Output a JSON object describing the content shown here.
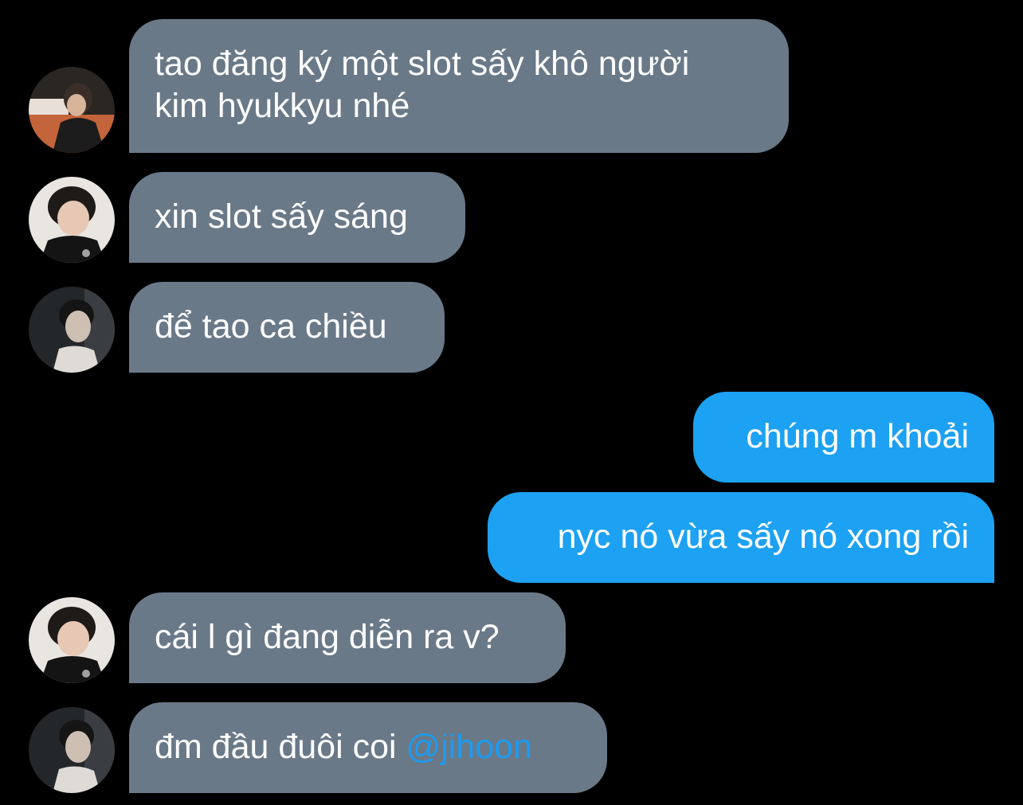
{
  "messages": [
    {
      "side": "in",
      "avatar": "avatar-faker",
      "line1": "tao đăng ký một slot sấy khô người",
      "line2": "kim hyukkyu nhé"
    },
    {
      "side": "in",
      "avatar": "avatar-keria",
      "text": "xin slot sấy sáng"
    },
    {
      "side": "in",
      "avatar": "avatar-gumayusi",
      "text": "để tao ca chiều"
    },
    {
      "side": "out",
      "text": "chúng m khoải"
    },
    {
      "side": "out",
      "text": "nyc nó vừa sấy nó xong rồi"
    },
    {
      "side": "in",
      "avatar": "avatar-keria",
      "text": "cái l gì đang diễn ra v?"
    },
    {
      "side": "in",
      "avatar": "avatar-gumayusi",
      "text": "đm đầu đuôi coi ",
      "mention": "@jihoon"
    }
  ],
  "colors": {
    "background": "#000000",
    "incoming_bubble": "#6a7988",
    "outgoing_bubble": "#1da1f2",
    "mention": "#1d9bf0",
    "text": "#ffffff"
  }
}
